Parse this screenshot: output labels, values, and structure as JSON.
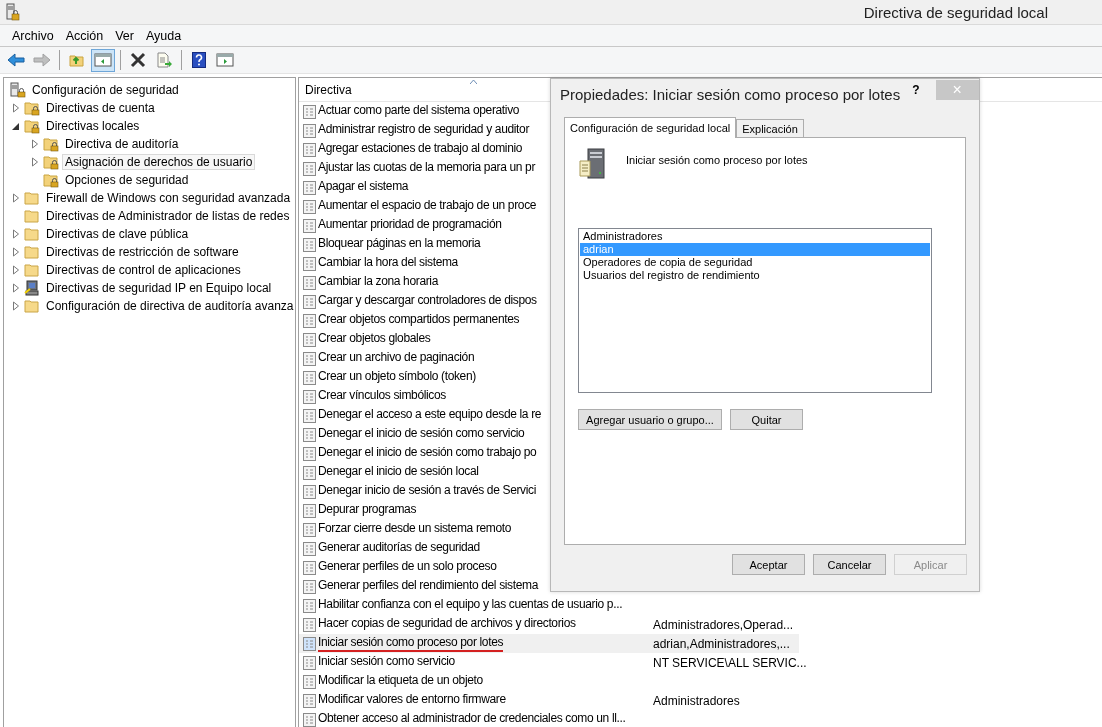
{
  "window": {
    "title": "Directiva de seguridad local"
  },
  "menu": [
    "Archivo",
    "Acción",
    "Ver",
    "Ayuda"
  ],
  "toolbar": [
    [
      {
        "kind": "back",
        "pressed": false,
        "disabled": false
      },
      {
        "kind": "forward",
        "pressed": false,
        "disabled": true
      }
    ],
    [
      {
        "kind": "up",
        "pressed": false,
        "disabled": false
      },
      {
        "kind": "tree",
        "pressed": true,
        "disabled": false
      }
    ],
    [
      {
        "kind": "delete",
        "pressed": false,
        "disabled": false
      },
      {
        "kind": "export",
        "pressed": false,
        "disabled": false
      }
    ],
    [
      {
        "kind": "help",
        "pressed": false,
        "disabled": false
      },
      {
        "kind": "pane",
        "pressed": false,
        "disabled": false
      }
    ]
  ],
  "tree": {
    "label": "Configuración de seguridad",
    "children": [
      {
        "label": "Directivas de cuenta",
        "kind": "locked",
        "expanded": false,
        "selected": false
      },
      {
        "label": "Directivas locales",
        "kind": "locked",
        "expanded": true,
        "selected": false,
        "children": [
          {
            "label": "Directiva de auditoría",
            "kind": "locked",
            "expanded": false,
            "selected": false
          },
          {
            "label": "Asignación de derechos de usuario",
            "kind": "locked",
            "expanded": false,
            "selected": true
          },
          {
            "label": "Opciones de seguridad",
            "kind": "locked",
            "selected": false
          }
        ]
      },
      {
        "label": "Firewall de Windows con seguridad avanzada",
        "kind": "folder",
        "expanded": false,
        "selected": false
      },
      {
        "label": "Directivas de Administrador de listas de redes",
        "kind": "folder",
        "selected": false
      },
      {
        "label": "Directivas de clave pública",
        "kind": "folder",
        "expanded": false,
        "selected": false
      },
      {
        "label": "Directivas de restricción de software",
        "kind": "folder",
        "expanded": false,
        "selected": false
      },
      {
        "label": "Directivas de control de aplicaciones",
        "kind": "folder",
        "expanded": false,
        "selected": false
      },
      {
        "label": "Directivas de seguridad IP en Equipo local",
        "kind": "computer",
        "expanded": false,
        "selected": false
      },
      {
        "label": "Configuración de directiva de auditoría avanza",
        "kind": "folder",
        "expanded": false,
        "selected": false
      }
    ]
  },
  "table": {
    "columns": [
      "Directiva"
    ],
    "rows": [
      {
        "name": "Actuar como parte del sistema operativo",
        "selected": false,
        "underlined": false
      },
      {
        "name": "Administrar registro de seguridad y auditor",
        "selected": false,
        "underlined": false
      },
      {
        "name": "Agregar estaciones de trabajo al dominio",
        "selected": false,
        "underlined": false
      },
      {
        "name": "Ajustar las cuotas de la memoria para un pr",
        "selected": false,
        "underlined": false
      },
      {
        "name": "Apagar el sistema",
        "selected": false,
        "underlined": false
      },
      {
        "name": "Aumentar el espacio de trabajo de un proce",
        "selected": false,
        "underlined": false
      },
      {
        "name": "Aumentar prioridad de programación",
        "selected": false,
        "underlined": false
      },
      {
        "name": "Bloquear páginas en la memoria",
        "selected": false,
        "underlined": false
      },
      {
        "name": "Cambiar la hora del sistema",
        "selected": false,
        "underlined": false
      },
      {
        "name": "Cambiar la zona horaria",
        "selected": false,
        "underlined": false
      },
      {
        "name": "Cargar y descargar controladores de dispos",
        "selected": false,
        "underlined": false
      },
      {
        "name": "Crear objetos compartidos permanentes",
        "selected": false,
        "underlined": false
      },
      {
        "name": "Crear objetos globales",
        "selected": false,
        "underlined": false
      },
      {
        "name": "Crear un archivo de paginación",
        "selected": false,
        "underlined": false
      },
      {
        "name": "Crear un objeto símbolo (token)",
        "selected": false,
        "underlined": false
      },
      {
        "name": "Crear vínculos simbólicos",
        "selected": false,
        "underlined": false
      },
      {
        "name": "Denegar el acceso a este equipo desde la re",
        "selected": false,
        "underlined": false
      },
      {
        "name": "Denegar el inicio de sesión como servicio",
        "selected": false,
        "underlined": false
      },
      {
        "name": "Denegar el inicio de sesión como trabajo po",
        "selected": false,
        "underlined": false
      },
      {
        "name": "Denegar el inicio de sesión local",
        "selected": false,
        "underlined": false
      },
      {
        "name": "Denegar inicio de sesión a través de Servici",
        "selected": false,
        "underlined": false
      },
      {
        "name": "Depurar programas",
        "selected": false,
        "underlined": false
      },
      {
        "name": "Forzar cierre desde un sistema remoto",
        "selected": false,
        "underlined": false
      },
      {
        "name": "Generar auditorías de seguridad",
        "selected": false,
        "underlined": false
      },
      {
        "name": "Generar perfiles de un solo proceso",
        "selected": false,
        "underlined": false
      },
      {
        "name": "Generar perfiles del rendimiento del sistema",
        "selected": false,
        "underlined": false
      },
      {
        "name": "Habilitar confianza con el equipo y las cuentas de usuario p...",
        "selected": false,
        "underlined": false
      },
      {
        "name": "Hacer copias de seguridad de archivos y directorios",
        "setting": "Administradores,Operad...",
        "selected": false,
        "underlined": false
      },
      {
        "name": "Iniciar sesión como proceso por lotes",
        "setting": "adrian,Administradores,...",
        "selected": true,
        "underlined": true
      },
      {
        "name": "Iniciar sesión como servicio",
        "setting": "NT SERVICE\\ALL SERVIC...",
        "selected": false,
        "underlined": false
      },
      {
        "name": "Modificar la etiqueta de un objeto",
        "selected": false,
        "underlined": false
      },
      {
        "name": "Modificar valores de entorno firmware",
        "setting": "Administradores",
        "selected": false,
        "underlined": false
      },
      {
        "name": "Obtener acceso al administrador de credenciales como un ll...",
        "selected": false,
        "underlined": false
      }
    ]
  },
  "dialog": {
    "title": "Propiedades: Iniciar sesión como proceso por lotes",
    "help": "?",
    "close": "×",
    "tabs": [
      {
        "label": "Configuración de seguridad local",
        "selected": true
      },
      {
        "label": "Explicación",
        "selected": false
      }
    ],
    "policy": "Iniciar sesión como proceso por lotes",
    "accounts": [
      {
        "name": "Administradores",
        "selected": false
      },
      {
        "name": "adrian",
        "selected": true
      },
      {
        "name": "Operadores de copia de seguridad",
        "selected": false
      },
      {
        "name": "Usuarios del registro de rendimiento",
        "selected": false
      }
    ],
    "list_buttons": [
      "Agregar usuario o grupo...",
      "Quitar"
    ],
    "buttons": [
      {
        "label": "Aceptar",
        "disabled": false
      },
      {
        "label": "Cancelar",
        "disabled": false
      },
      {
        "label": "Aplicar",
        "disabled": true
      }
    ]
  }
}
